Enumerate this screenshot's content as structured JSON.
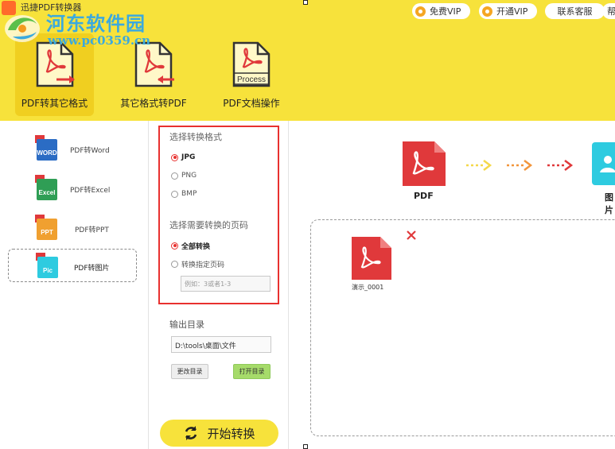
{
  "app": {
    "title": "迅捷PDF转换器"
  },
  "watermark": {
    "site_name": "河东软件园",
    "url": "www.pc0359.cn"
  },
  "header_buttons": {
    "free_vip": "免费VIP",
    "open_vip": "开通VIP",
    "contact": "联系客服",
    "help": "帮助"
  },
  "main_tabs": [
    {
      "label": "PDF转其它格式",
      "active": true
    },
    {
      "label": "其它格式转PDF",
      "active": false
    },
    {
      "label": "PDF文档操作",
      "active": false,
      "icon_text": "Process"
    }
  ],
  "sidebar": {
    "items": [
      {
        "label": "PDF转Word",
        "icon": "word-icon",
        "icon_text": "WORD",
        "active": false
      },
      {
        "label": "PDF转Excel",
        "icon": "excel-icon",
        "icon_text": "Excel",
        "active": false
      },
      {
        "label": "PDF转PPT",
        "icon": "ppt-icon",
        "icon_text": "PPT",
        "active": false
      },
      {
        "label": "PDF转图片",
        "icon": "pic-icon",
        "icon_text": "Pic",
        "active": true
      }
    ]
  },
  "options": {
    "format_title": "选择转换格式",
    "formats": [
      {
        "label": "JPG",
        "checked": true
      },
      {
        "label": "PNG",
        "checked": false
      },
      {
        "label": "BMP",
        "checked": false
      }
    ],
    "pages_title": "选择需要转换的页码",
    "page_modes": [
      {
        "label": "全部转换",
        "checked": true
      },
      {
        "label": "转换指定页码",
        "checked": false
      }
    ],
    "page_input_placeholder": "例如：3或者1-3",
    "output_title": "输出目录",
    "output_path": "D:\\tools\\桌面\\文件",
    "change_dir": "更改目录",
    "open_dir": "打开目录",
    "start": "开始转换"
  },
  "flow": {
    "source_label": "PDF",
    "target_label": "图片"
  },
  "files": [
    {
      "name": "演示_0001"
    }
  ],
  "colors": {
    "accent_yellow": "#f7e23b",
    "pdf_red": "#e0393b",
    "highlight_red": "#e8312f",
    "open_dir_green": "#a6db6a"
  }
}
